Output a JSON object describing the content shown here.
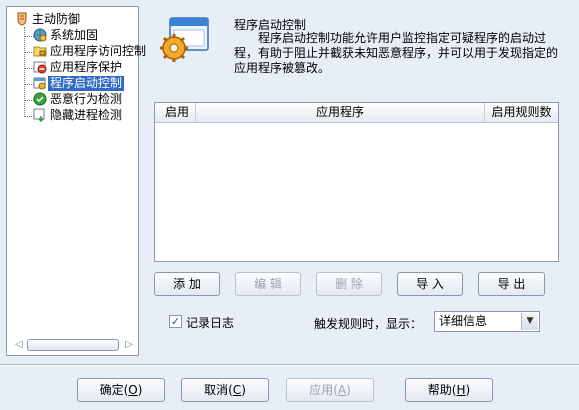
{
  "tree": {
    "root": {
      "label": "主动防御",
      "icon": "shield-hand-icon"
    },
    "items": [
      {
        "label": "系统加固",
        "icon": "globe-gear-icon"
      },
      {
        "label": "应用程序访问控制",
        "icon": "folder-lock-icon"
      },
      {
        "label": "应用程序保护",
        "icon": "app-no-entry-icon"
      },
      {
        "label": "程序启动控制",
        "icon": "app-launch-icon",
        "selected": true
      },
      {
        "label": "恶意行为检测",
        "icon": "green-shield-icon"
      },
      {
        "label": "隐藏进程检测",
        "icon": "process-search-icon"
      }
    ]
  },
  "header": {
    "icon": "window-gear-icon",
    "title": "程序启动控制",
    "description": "程序启动控制功能允许用户监控指定可疑程序的启动过程，有助于阻止并截获未知恶意程序，并可以用于发现指定的应用程序被篡改。"
  },
  "list": {
    "columns": [
      "启用",
      "应用程序",
      "启用规则数"
    ],
    "rows": []
  },
  "actions": {
    "add": "添 加",
    "edit": "编 辑",
    "delete": "删 除",
    "import": "导 入",
    "export": "导 出"
  },
  "options": {
    "log_label": "记录日志",
    "log_checked": true,
    "trigger_label": "触发规则时，显示：",
    "display_value": "详细信息"
  },
  "footer": {
    "ok": {
      "text": "确定(",
      "key": "O",
      "suffix": ")"
    },
    "cancel": {
      "text": "取消(",
      "key": "C",
      "suffix": ")"
    },
    "apply": {
      "text": "应用(",
      "key": "A",
      "suffix": ")"
    },
    "help": {
      "text": "帮助(",
      "key": "H",
      "suffix": ")"
    }
  },
  "colors": {
    "background": "#e8eef6",
    "selection": "#316ac5",
    "border": "#8a9bb1"
  }
}
